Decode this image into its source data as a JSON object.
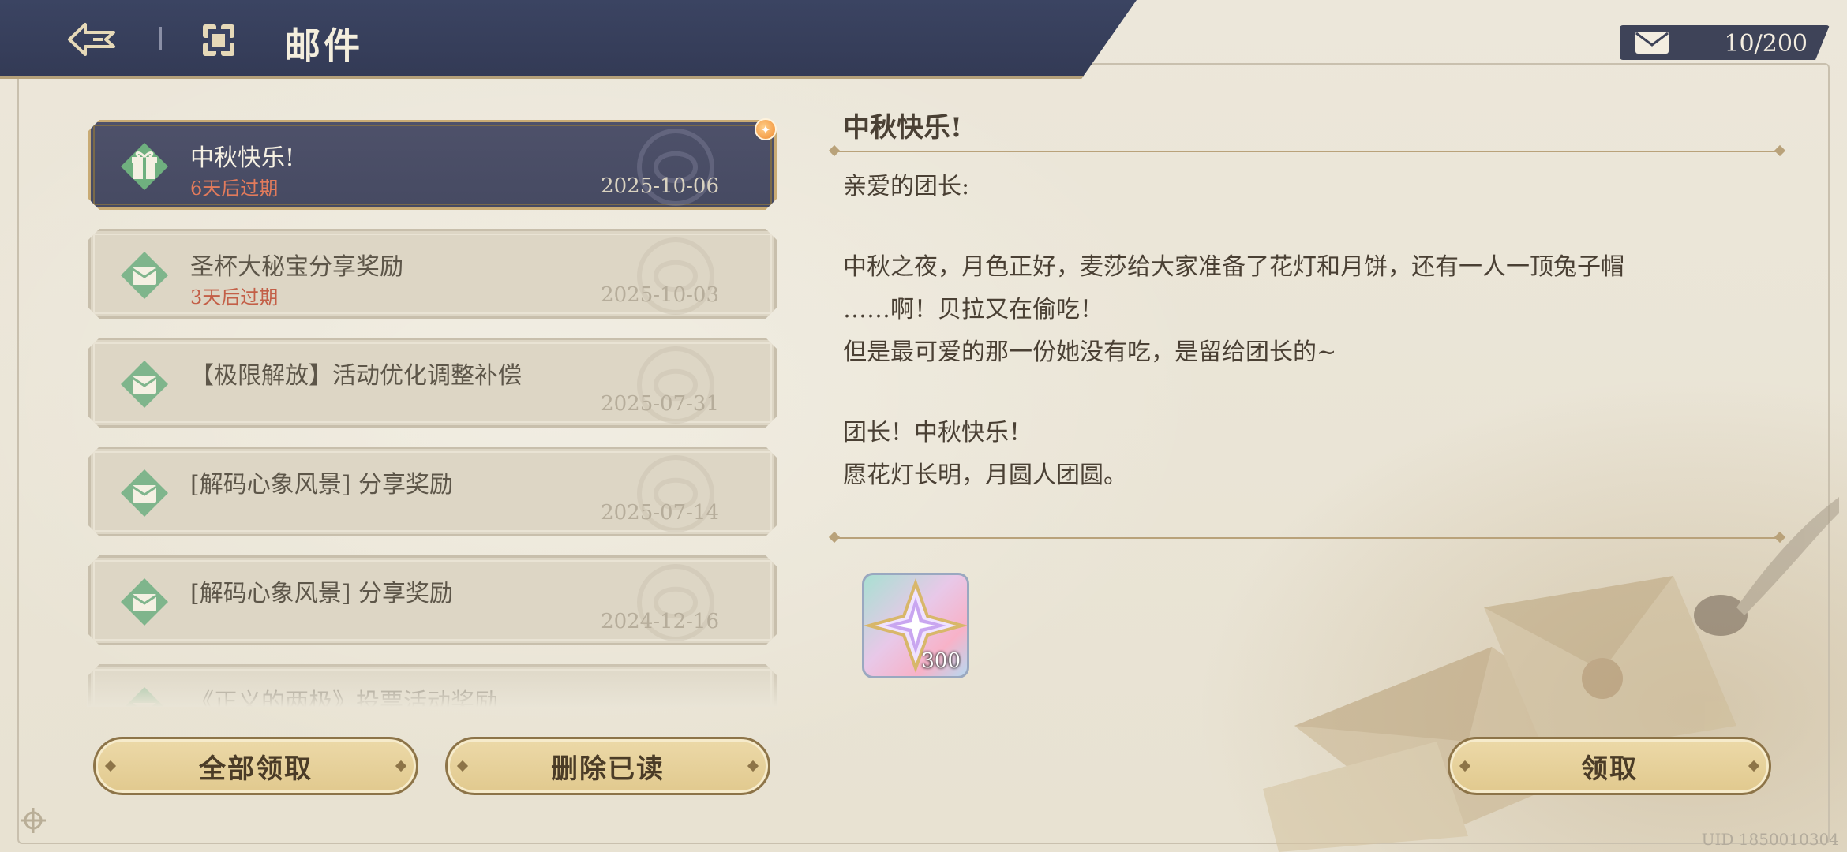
{
  "header": {
    "title": "邮件"
  },
  "mail_counter": {
    "icon": "envelope-icon",
    "text": "10/200"
  },
  "mail_list": [
    {
      "title": "中秋快乐!",
      "expire": "6天后过期",
      "date": "2025-10-06",
      "icon": "gift-icon",
      "active": true
    },
    {
      "title": "圣杯大秘宝分享奖励",
      "expire": "3天后过期",
      "date": "2025-10-03",
      "icon": "mail-icon"
    },
    {
      "title": "【极限解放】活动优化调整补偿",
      "expire": "",
      "date": "2025-07-31",
      "icon": "mail-icon"
    },
    {
      "title": "[解码心象风景] 分享奖励",
      "expire": "",
      "date": "2025-07-14",
      "icon": "mail-icon"
    },
    {
      "title": "[解码心象风景] 分享奖励",
      "expire": "",
      "date": "2024-12-16",
      "icon": "mail-icon"
    },
    {
      "title": "《正义的两极》投票活动奖励",
      "expire": "",
      "date": "",
      "icon": "mail-icon"
    }
  ],
  "buttons": {
    "claim_all": "全部领取",
    "delete_read": "删除已读",
    "claim": "领取"
  },
  "mail_detail": {
    "title": "中秋快乐!",
    "greeting": "亲爱的团长:",
    "lines": [
      "中秋之夜，月色正好，麦莎给大家准备了花灯和月饼，还有一人一顶兔子帽",
      "……啊！贝拉又在偷吃！",
      "但是最可爱的那一份她没有吃，是留给团长的~",
      "团长！中秋快乐！",
      "愿花灯长明，月圆人团圆。"
    ],
    "reward": {
      "icon": "crystal-star-icon",
      "quantity": "300"
    }
  },
  "footer": {
    "uid": "UID 1850010304"
  },
  "colors": {
    "header_bg": "#3b4462",
    "accent_gold": "#b6a17a",
    "expire_red": "#c35f47",
    "button_fill": "#e1c98e"
  }
}
